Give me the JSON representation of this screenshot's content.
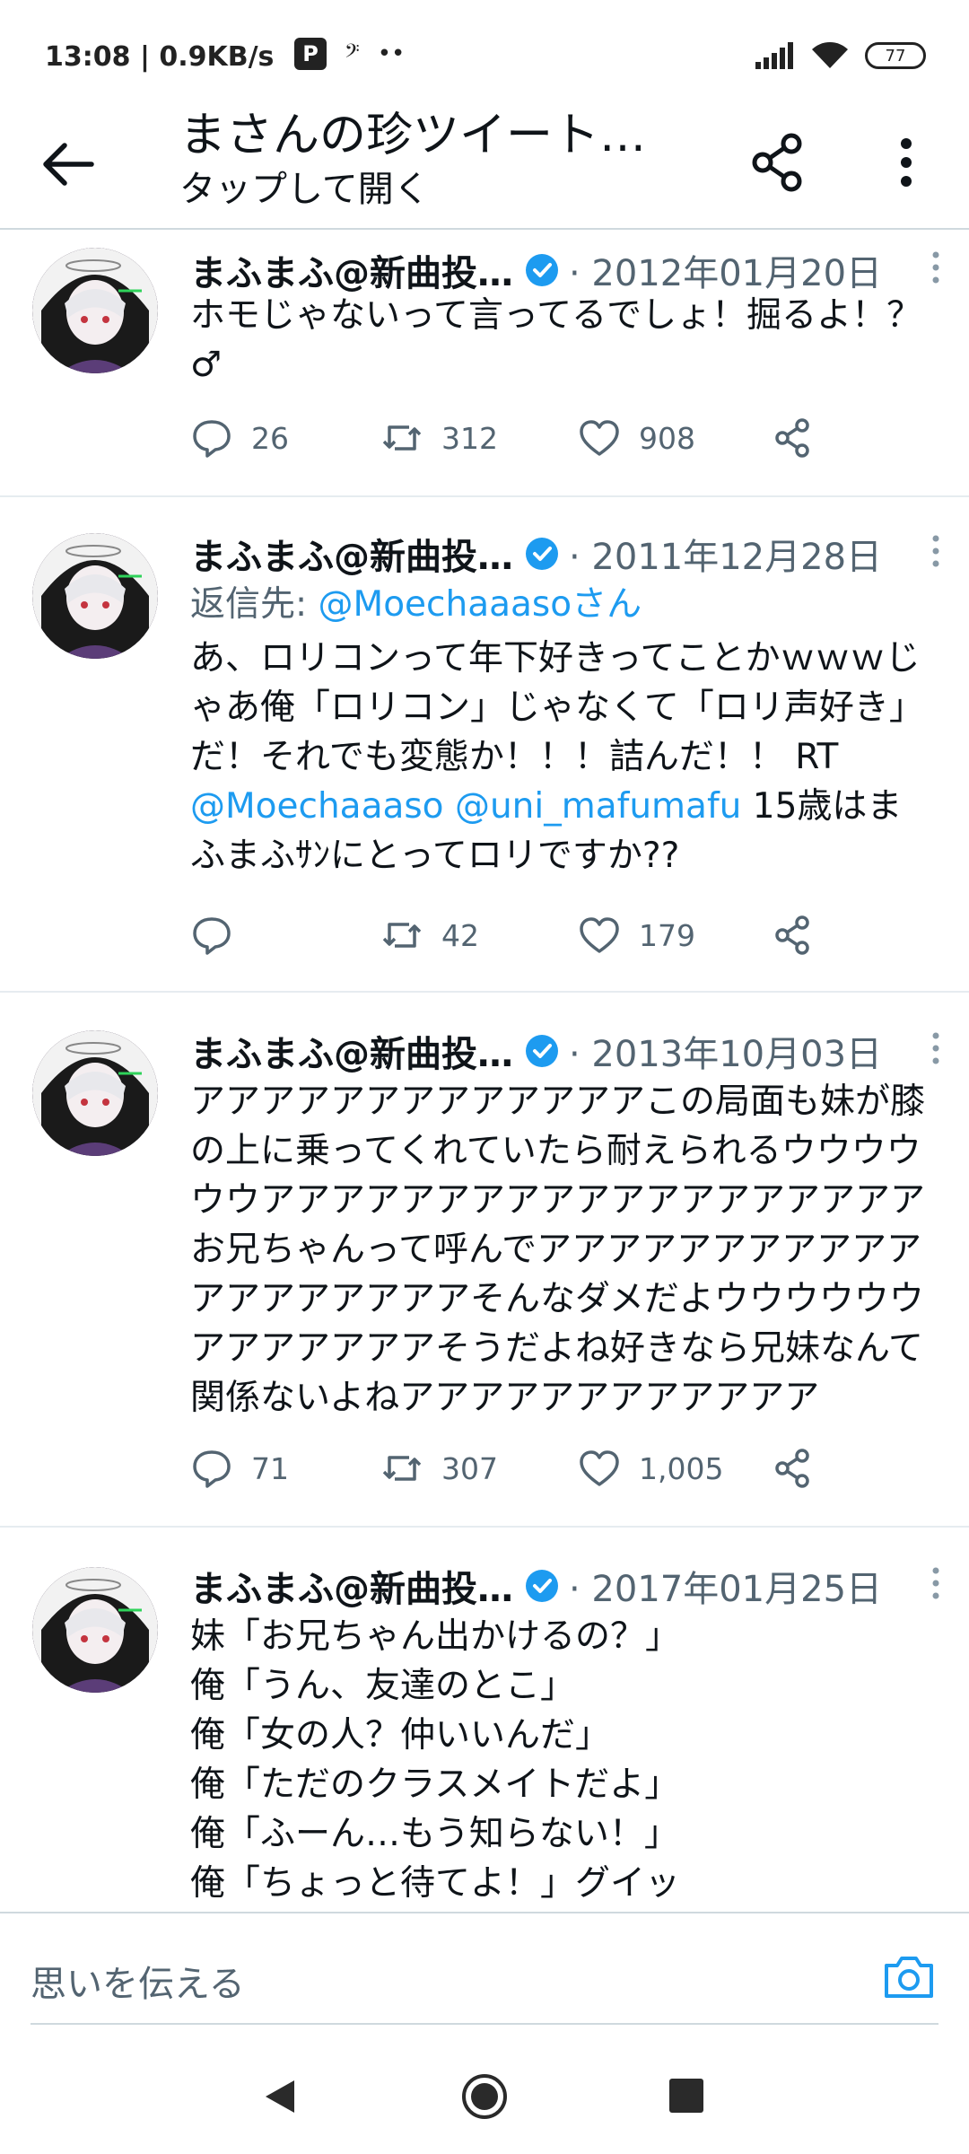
{
  "status_bar": {
    "time": "13:08 | 0.9KB/s",
    "left_icons": [
      "P",
      "𝄢"
    ],
    "dots": "••",
    "battery": "77"
  },
  "header": {
    "title": "まさんの珍ツイート…",
    "subtitle": "タップして開く"
  },
  "tweets": [
    {
      "author": "まふまふ@新曲投…",
      "date": "· 2012年01月20日",
      "body": "ホモじゃないって言ってるでしょ！掘るよ！？♂",
      "reply": 26,
      "retweet": 312,
      "like": 908
    },
    {
      "author": "まふまふ@新曲投…",
      "date": "· 2011年12月28日",
      "reply_label": "返信先: ",
      "reply_to": "@Moechaaasoさん",
      "body_pre": "あ、ロリコンって年下好きってことかｗｗｗじゃあ俺「ロリコン」じゃなくて「ロリ声好き」だ！それでも変態か！！！詰んだ！！ RT ",
      "mention_1": "@Moechaaaso",
      "mention_2": "@uni_mafumafu",
      "body_post": " 15歳はまふまふｻﾝにとってロリですか??",
      "reply": "",
      "retweet": 42,
      "like": 179
    },
    {
      "author": "まふまふ@新曲投…",
      "date": "· 2013年10月03日",
      "body": "アアアアアアアアアアアアアこの局面も妹が膝の上に乗ってくれていたら耐えられるウウウウウウアアアアアアアアアアアアアアアアアアアお兄ちゃんって呼んでアアアアアアアアアアアアアアアアアアアそんなダメだよウウウウウウアアアアアアアそうだよね好きなら兄妹なんて関係ないよねアアアアアアアアアアアア",
      "reply": 71,
      "retweet": 307,
      "like": "1,005"
    },
    {
      "author": "まふまふ@新曲投…",
      "date": "· 2017年01月25日",
      "lines": [
        "妹「お兄ちゃん出かけるの？」",
        "俺「うん、友達のとこ」",
        "俺「女の人？仲いいんだ」",
        "俺「ただのクラスメイトだよ」",
        "俺「ふーん…もう知らない！」",
        "俺「ちょっと待てよ！」グイッ"
      ]
    }
  ],
  "compose": {
    "placeholder": "思いを伝える"
  },
  "colors": {
    "accent": "#1d9bf0",
    "muted": "#536471",
    "text": "#0f1419"
  }
}
